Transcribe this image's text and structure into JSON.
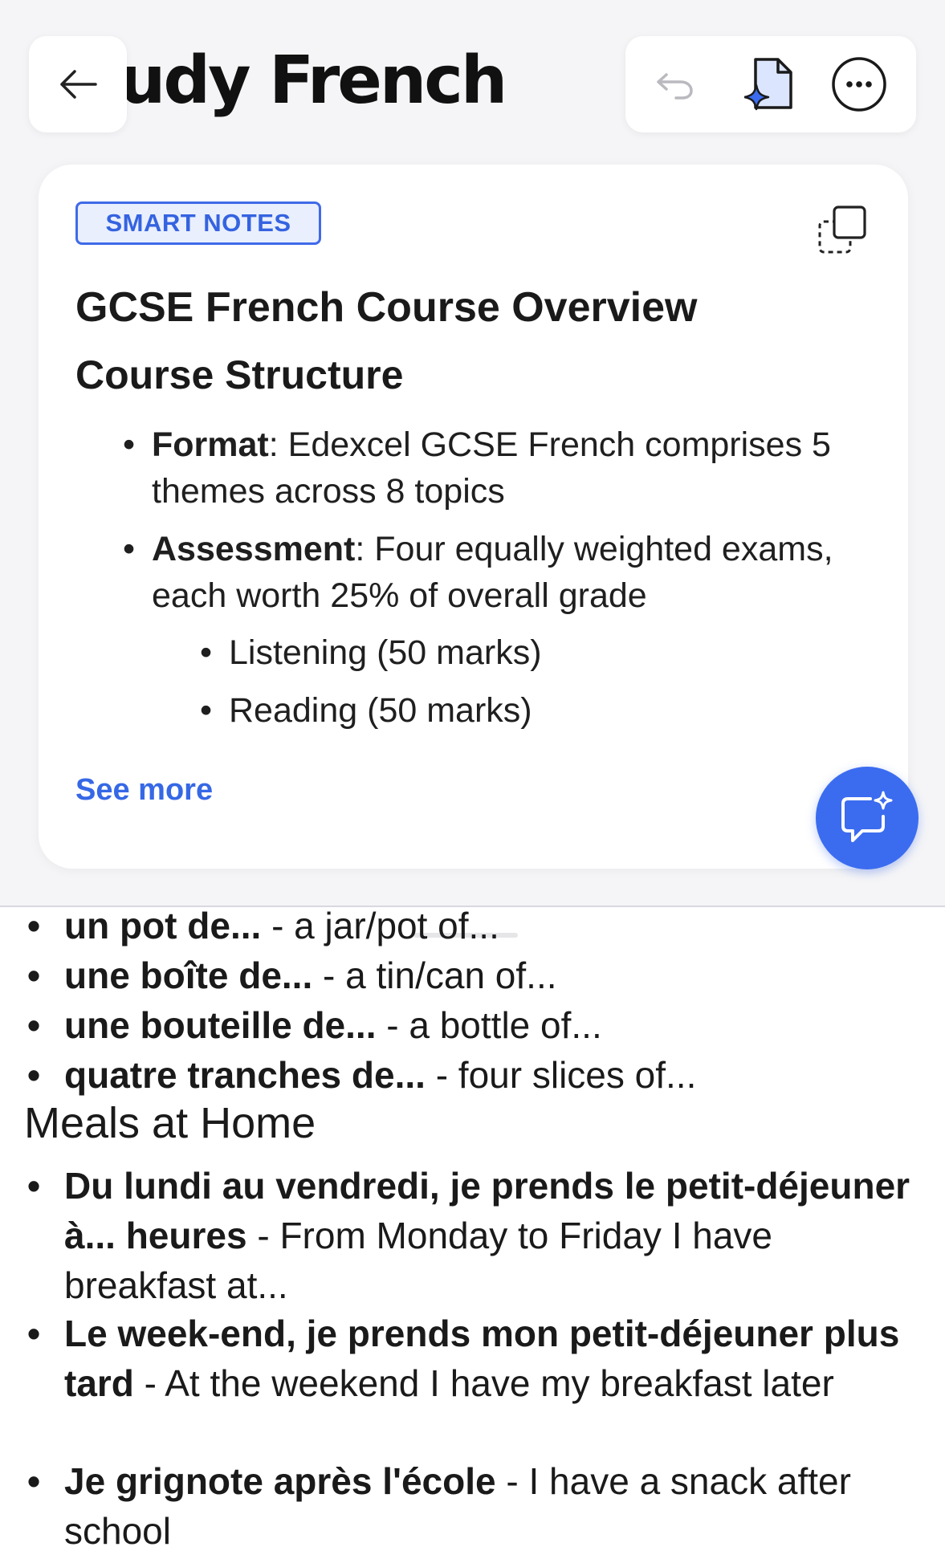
{
  "header": {
    "title": "udy French",
    "back_icon": "arrow-left-icon",
    "toolbar": {
      "undo_icon": "undo-icon",
      "ai_document_icon": "ai-document-icon",
      "more_icon": "more-horizontal-icon"
    }
  },
  "card": {
    "badge": "SMART NOTES",
    "copy_icon": "copy-icon",
    "title": "GCSE French Course Overview",
    "section_heading": "Course Structure",
    "bullets": [
      {
        "label": "Format",
        "sep": ": ",
        "text": "Edexcel GCSE French comprises 5 themes across 8 topics"
      },
      {
        "label": "Assessment",
        "sep": ": ",
        "text": "Four equally weighted exams, each worth 25% of overall grade"
      }
    ],
    "sub_bullets": [
      "Listening (50 marks)",
      "Reading (50 marks)"
    ],
    "see_more": "See more"
  },
  "fab": {
    "icon": "ai-chat-icon"
  },
  "document": {
    "items": [
      {
        "bold": "un pot de...",
        "text": " - a jar/pot of..."
      },
      {
        "bold": "une boîte de...",
        "text": " - a tin/can of..."
      },
      {
        "bold": "une bouteille de...",
        "text": " - a bottle of..."
      },
      {
        "bold": "quatre tranches de...",
        "text": " - four slices of..."
      }
    ],
    "heading": "Meals at Home",
    "meal_items": [
      {
        "bold": "Du lundi au vendredi, je prends le petit-déjeuner à... heures",
        "text": " - From Monday to Friday I have breakfast at..."
      },
      {
        "bold": "Le week-end, je prends mon petit-déjeuner plus tard",
        "text": " - At the weekend I have my breakfast later"
      },
      {
        "bold": "Je grignote après l'école",
        "text": " - I have a snack after school"
      }
    ]
  },
  "colors": {
    "accent": "#3b6cf0",
    "badge_bg": "#e9effd",
    "background": "#f5f5f7"
  }
}
